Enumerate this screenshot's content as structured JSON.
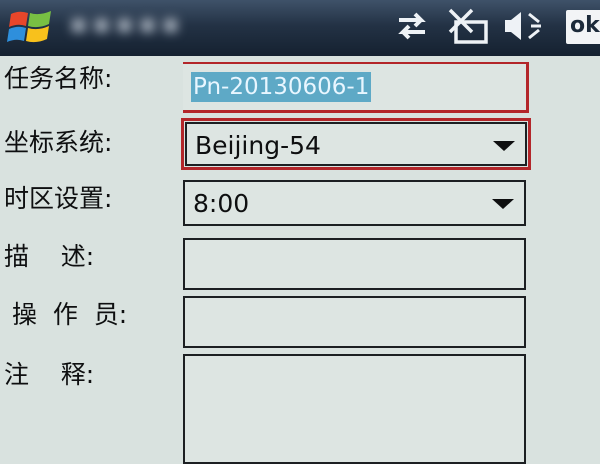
{
  "taskbar": {
    "title": "■■■■■",
    "ok_label": "ok"
  },
  "form": {
    "task_name_label": "任务名称:",
    "task_name_value": "Pn-20130606-1",
    "coord_system_label": "坐标系统:",
    "coord_system_value": "Beijing-54",
    "timezone_label": "时区设置:",
    "timezone_value": "8:00",
    "description_label": "描    述:",
    "operator_label": " 操  作  员:",
    "notes_label": "注    释:"
  },
  "colors": {
    "highlight": "#b3262a",
    "selection": "#5ea9c6"
  },
  "icons": [
    "windows-logo-icon",
    "sync-icon",
    "phone-signal-icon",
    "speaker-icon"
  ]
}
